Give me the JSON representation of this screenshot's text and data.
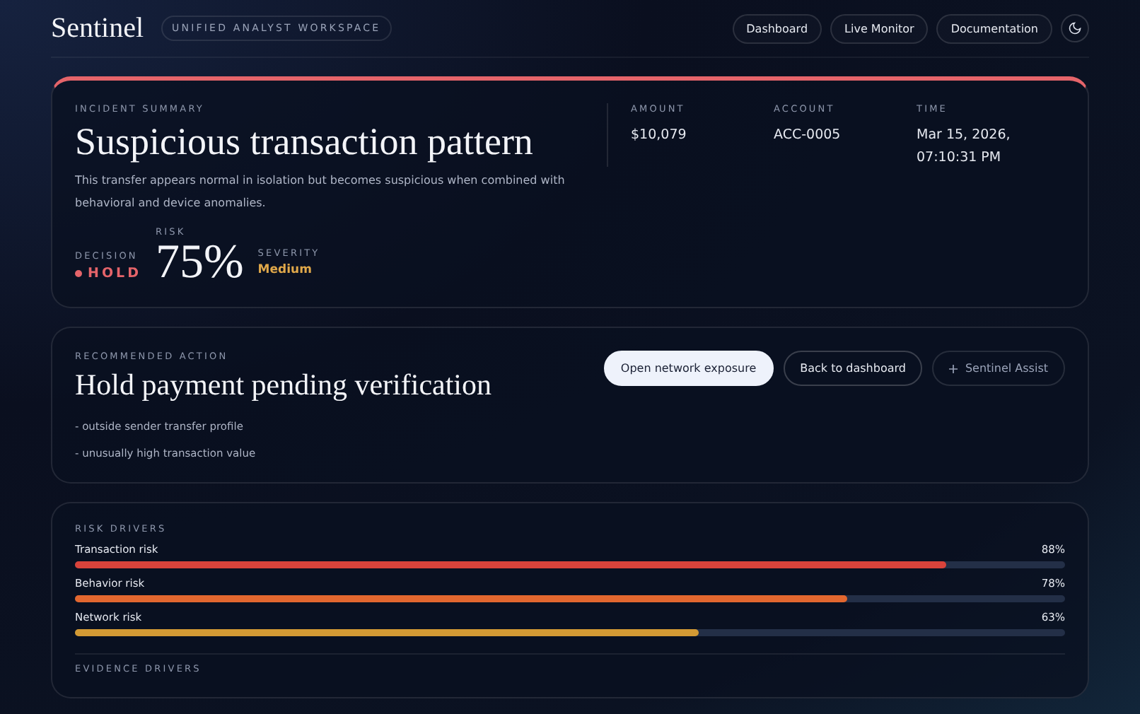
{
  "header": {
    "brand": "Sentinel",
    "workspace": "UNIFIED ANALYST WORKSPACE",
    "nav": [
      {
        "label": "Dashboard"
      },
      {
        "label": "Live Monitor"
      },
      {
        "label": "Documentation"
      }
    ]
  },
  "incident": {
    "eyebrow": "INCIDENT SUMMARY",
    "title": "Suspicious transaction pattern",
    "description": "This transfer appears normal in isolation but becomes suspicious when combined with behavioral and device anomalies.",
    "stats": [
      {
        "kind": "decision",
        "label": "DECISION",
        "value": "HOLD",
        "color": "#e5646a"
      },
      {
        "kind": "risk",
        "label": "RISK",
        "value": "75%"
      },
      {
        "kind": "severity",
        "label": "SEVERITY",
        "value": "Medium",
        "color": "#e0a84a"
      }
    ],
    "facts": [
      {
        "label": "AMOUNT",
        "value": "$10,079"
      },
      {
        "label": "ACCOUNT",
        "value": "ACC-0005"
      },
      {
        "label": "TIME",
        "value": "Mar 15, 2026, 07:10:31 PM"
      }
    ]
  },
  "action": {
    "eyebrow": "RECOMMENDED ACTION",
    "title": "Hold payment pending verification",
    "reasons": [
      "- outside sender transfer profile",
      "- unusually high transaction value"
    ],
    "buttons": [
      {
        "label": "Open network exposure",
        "kind": "primary"
      },
      {
        "label": "Back to dashboard",
        "kind": "outline"
      },
      {
        "label": "Sentinel Assist",
        "kind": "assist"
      }
    ]
  },
  "drivers": {
    "eyebrow": "RISK DRIVERS",
    "items": [
      {
        "name": "Transaction risk",
        "reading": "88%",
        "level": 0.88,
        "color": "#d9433b"
      },
      {
        "name": "Behavior risk",
        "reading": "78%",
        "level": 0.78,
        "color": "#e2672f"
      },
      {
        "name": "Network risk",
        "reading": "63%",
        "level": 0.63,
        "color": "#d39a34"
      }
    ],
    "next_section": "EVIDENCE DRIVERS"
  }
}
